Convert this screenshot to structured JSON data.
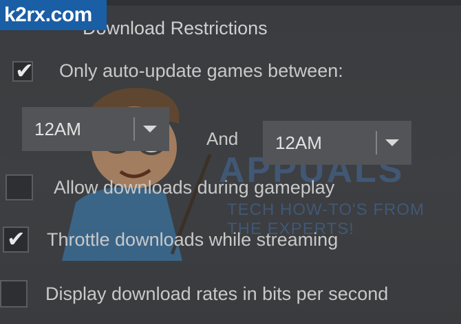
{
  "watermark": {
    "logo_text": "k2rx.com",
    "brand": "APPUALS",
    "tagline_line1": "TECH HOW-TO'S FROM",
    "tagline_line2": "THE EXPERTS!"
  },
  "section": {
    "title": "Download Restrictions"
  },
  "options": [
    {
      "label": "Only auto-update games between:",
      "checked": true
    },
    {
      "label": "Allow downloads during gameplay",
      "checked": false
    },
    {
      "label": "Throttle downloads while streaming",
      "checked": true
    },
    {
      "label": "Display download rates in bits per second",
      "checked": false
    }
  ],
  "schedule": {
    "start_value": "12AM",
    "and_label": "And",
    "end_value": "12AM"
  },
  "icons": {
    "check": "checkmark-icon",
    "dropdown": "chevron-down-icon"
  },
  "colors": {
    "background": "#3b3d40",
    "dropdown_bg": "#525457",
    "text": "#c9c9c9",
    "logo_bg": "#1a5ea5"
  }
}
